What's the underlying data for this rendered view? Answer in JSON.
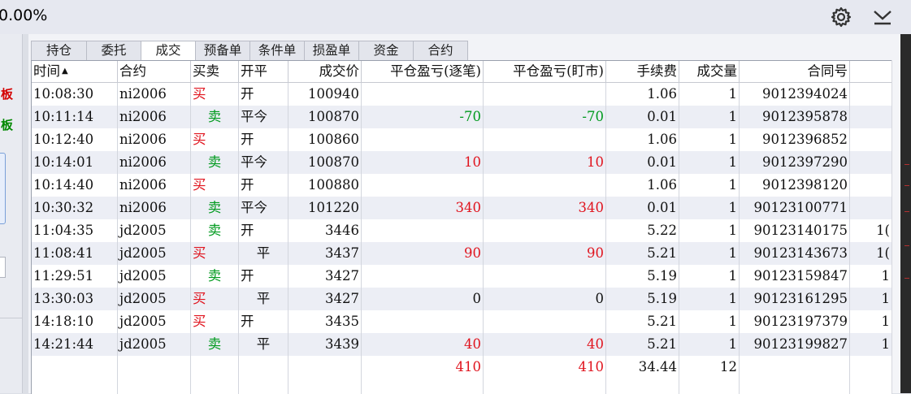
{
  "header": {
    "percent_text": "0.00%",
    "icons": {
      "settings": "gear-icon",
      "collapse": "chevron-down-icon"
    }
  },
  "left_panel": {
    "red_label": "板",
    "green_label": "板"
  },
  "tabs": [
    {
      "label": "持仓",
      "active": false
    },
    {
      "label": "委托",
      "active": false
    },
    {
      "label": "成交",
      "active": true
    },
    {
      "label": "预备单",
      "active": false
    },
    {
      "label": "条件单",
      "active": false
    },
    {
      "label": "损盈单",
      "active": false
    },
    {
      "label": "资金",
      "active": false
    },
    {
      "label": "合约",
      "active": false
    }
  ],
  "table": {
    "columns": [
      "时间",
      "合约",
      "买卖",
      "开平",
      "成交价",
      "平仓盈亏(逐笔)",
      "平仓盈亏(盯市)",
      "手续费",
      "成交量",
      "合同号"
    ],
    "sort_indicator": "▲",
    "rows": [
      {
        "time": "10:08:30",
        "contract": "ni2006",
        "side": "买",
        "oc": "开",
        "price": "100940",
        "pnl_trade": "",
        "pnl_mark": "",
        "fee": "1.06",
        "qty": "1",
        "order_no": "9012394024",
        "extra": ""
      },
      {
        "time": "10:11:14",
        "contract": "ni2006",
        "side": "卖",
        "oc": "平今",
        "price": "100870",
        "pnl_trade": "-70",
        "pnl_mark": "-70",
        "fee": "0.01",
        "qty": "1",
        "order_no": "9012395878",
        "extra": ""
      },
      {
        "time": "10:12:40",
        "contract": "ni2006",
        "side": "买",
        "oc": "开",
        "price": "100860",
        "pnl_trade": "",
        "pnl_mark": "",
        "fee": "1.06",
        "qty": "1",
        "order_no": "9012396852",
        "extra": ""
      },
      {
        "time": "10:14:01",
        "contract": "ni2006",
        "side": "卖",
        "oc": "平今",
        "price": "100870",
        "pnl_trade": "10",
        "pnl_mark": "10",
        "fee": "0.01",
        "qty": "1",
        "order_no": "9012397290",
        "extra": ""
      },
      {
        "time": "10:14:40",
        "contract": "ni2006",
        "side": "买",
        "oc": "开",
        "price": "100880",
        "pnl_trade": "",
        "pnl_mark": "",
        "fee": "1.06",
        "qty": "1",
        "order_no": "9012398120",
        "extra": ""
      },
      {
        "time": "10:30:32",
        "contract": "ni2006",
        "side": "卖",
        "oc": "平今",
        "price": "101220",
        "pnl_trade": "340",
        "pnl_mark": "340",
        "fee": "0.01",
        "qty": "1",
        "order_no": "90123100771",
        "extra": ""
      },
      {
        "time": "11:04:35",
        "contract": "jd2005",
        "side": "卖",
        "oc": "开",
        "price": "3446",
        "pnl_trade": "",
        "pnl_mark": "",
        "fee": "5.22",
        "qty": "1",
        "order_no": "90123140175",
        "extra": "1("
      },
      {
        "time": "11:08:41",
        "contract": "jd2005",
        "side": "买",
        "oc": "平",
        "price": "3437",
        "pnl_trade": "90",
        "pnl_mark": "90",
        "fee": "5.21",
        "qty": "1",
        "order_no": "90123143673",
        "extra": "1("
      },
      {
        "time": "11:29:51",
        "contract": "jd2005",
        "side": "卖",
        "oc": "开",
        "price": "3427",
        "pnl_trade": "",
        "pnl_mark": "",
        "fee": "5.19",
        "qty": "1",
        "order_no": "90123159847",
        "extra": "1"
      },
      {
        "time": "13:30:03",
        "contract": "jd2005",
        "side": "买",
        "oc": "平",
        "price": "3427",
        "pnl_trade": "0",
        "pnl_mark": "0",
        "fee": "5.19",
        "qty": "1",
        "order_no": "90123161295",
        "extra": "1"
      },
      {
        "time": "14:18:10",
        "contract": "jd2005",
        "side": "买",
        "oc": "开",
        "price": "3435",
        "pnl_trade": "",
        "pnl_mark": "",
        "fee": "5.21",
        "qty": "1",
        "order_no": "90123197379",
        "extra": "1"
      },
      {
        "time": "14:21:44",
        "contract": "jd2005",
        "side": "卖",
        "oc": "平",
        "price": "3439",
        "pnl_trade": "40",
        "pnl_mark": "40",
        "fee": "5.21",
        "qty": "1",
        "order_no": "90123199827",
        "extra": "1"
      }
    ],
    "totals": {
      "pnl_trade": "410",
      "pnl_mark": "410",
      "fee": "34.44",
      "qty": "12"
    }
  },
  "colors": {
    "buy": "#e0141e",
    "sell": "#009a1e",
    "loss": "#009a1e",
    "profit": "#e0141e"
  }
}
